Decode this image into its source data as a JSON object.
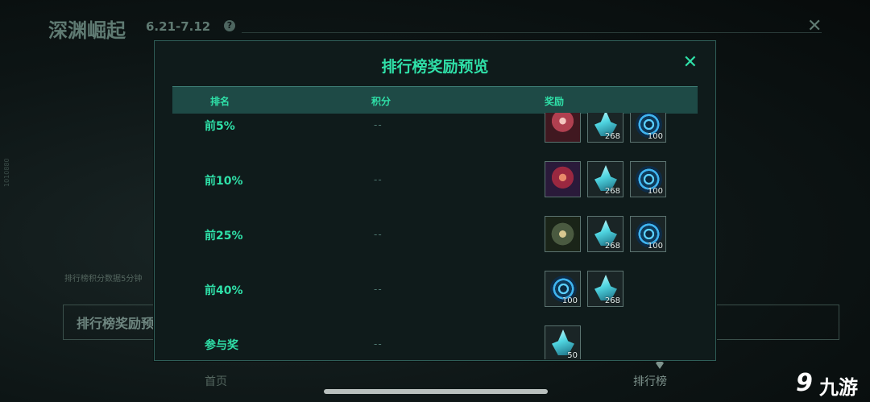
{
  "background": {
    "title": "深渊崛起",
    "dates": "6.21-7.12",
    "help_icon": "?",
    "close_icon": "✕",
    "note": "排行榜积分数据5分钟",
    "button_label": "排行榜奖励预",
    "nav_home": "首页",
    "nav_rank": "排行榜",
    "side_text": "1010880"
  },
  "modal": {
    "title": "排行榜奖励预览",
    "close_icon": "✕",
    "headers": {
      "rank": "排名",
      "score": "积分",
      "reward": "奖励"
    },
    "rows": [
      {
        "rank": "前5%",
        "score": "--",
        "rewards": [
          {
            "icon": "skin-portrait-icon",
            "count": ""
          },
          {
            "icon": "crystal-icon",
            "count": "268"
          },
          {
            "icon": "orb-icon",
            "count": "100"
          }
        ]
      },
      {
        "rank": "前10%",
        "score": "--",
        "rewards": [
          {
            "icon": "skin-portrait-icon",
            "count": ""
          },
          {
            "icon": "crystal-icon",
            "count": "268"
          },
          {
            "icon": "orb-icon",
            "count": "100"
          }
        ]
      },
      {
        "rank": "前25%",
        "score": "--",
        "rewards": [
          {
            "icon": "skin-portrait-icon",
            "count": ""
          },
          {
            "icon": "crystal-icon",
            "count": "268"
          },
          {
            "icon": "orb-icon",
            "count": "100"
          }
        ]
      },
      {
        "rank": "前40%",
        "score": "--",
        "rewards": [
          {
            "icon": "orb-icon",
            "count": "100"
          },
          {
            "icon": "crystal-icon",
            "count": "268"
          }
        ]
      },
      {
        "rank": "参与奖",
        "score": "--",
        "rewards": [
          {
            "icon": "crystal-icon",
            "count": "50"
          }
        ]
      }
    ]
  },
  "watermark": {
    "logo": "9",
    "text": "九游"
  },
  "colors": {
    "accent": "#2fe0a8",
    "header_bg": "#1e4a46",
    "modal_bg": "#0f1b1b"
  }
}
